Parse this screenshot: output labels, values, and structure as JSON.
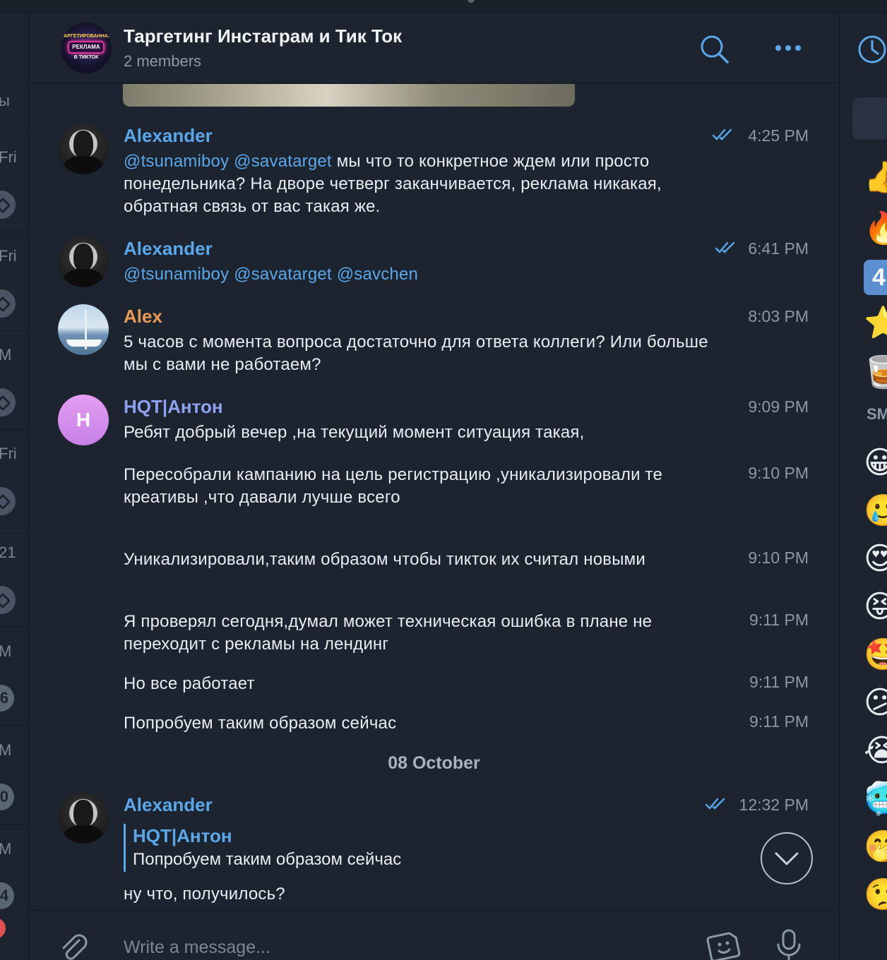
{
  "header": {
    "title": "Таргетинг Инстаграм и Тик Ток",
    "subtitle": "2 members",
    "avatar_text_top": "ТАРГЕТИРОВАННАЯ",
    "avatar_text_mid": "РЕКЛАМА",
    "avatar_text_bot": "В ТИКТОК"
  },
  "left_strip": {
    "items": [
      "ы",
      "Fri",
      "Fri",
      "M",
      "Fri",
      "21",
      "M",
      "6",
      "M",
      "0",
      "M",
      "4"
    ]
  },
  "right_strip": {
    "label": "SM",
    "badge": "4",
    "emojis": [
      "👍",
      "🔥",
      "⭐",
      "🥃",
      "😀",
      "🥲",
      "😍",
      "😝",
      "🤩",
      "😕",
      "😭",
      "🥶",
      "🤭",
      "🤥"
    ]
  },
  "messages": [
    {
      "sender": "Alexander",
      "mentions": [
        "@tsunamiboy",
        "@savatarget"
      ],
      "text": "мы что то конкретное ждем или просто понедельника? На дворе четверг заканчивается, реклама никакая, обратная связь от вас такая же.",
      "time": "4:25 PM"
    },
    {
      "sender": "Alexander",
      "mentions": [
        "@tsunamiboy",
        "@savatarget",
        "@savchen"
      ],
      "time": "6:41 PM"
    },
    {
      "sender": "Alex",
      "text": "5 часов с момента вопроса достаточно для ответа коллеги? Или больше мы с вами не работаем?",
      "time": "8:03 PM"
    },
    {
      "sender": "HQT|Антон",
      "avatar_letter": "H",
      "text": "Ребят добрый вечер ,на текущий момент ситуация такая,",
      "time": "9:09 PM"
    },
    {
      "text": "Пересобрали кампанию на цель регистрацию ,уникализировали те креативы ,что давали лучше всего",
      "time": "9:10 PM"
    },
    {
      "text": "Уникализировали,таким образом чтобы тикток их считал новыми",
      "time": "9:10 PM"
    },
    {
      "text": "Я проверял сегодня,думал может техническая ошибка в плане не переходит с рекламы на лендинг",
      "time": "9:11 PM"
    },
    {
      "text": "Но все работает",
      "time": "9:11 PM"
    },
    {
      "text": "Попробуем таким образом сейчас",
      "time": "9:11 PM"
    }
  ],
  "date_separator": "08 October",
  "last_message": {
    "sender": "Alexander",
    "reply_name": "HQT|Антон",
    "reply_text": "Попробуем таким образом сейчас",
    "text": "ну что, получилось?",
    "time": "12:32 PM"
  },
  "composer": {
    "placeholder": "Write a message..."
  },
  "colors": {
    "background": "#1c2430",
    "accent": "#5aa7ea",
    "orange_name": "#e99a55",
    "violet_name": "#8ea0f0"
  }
}
